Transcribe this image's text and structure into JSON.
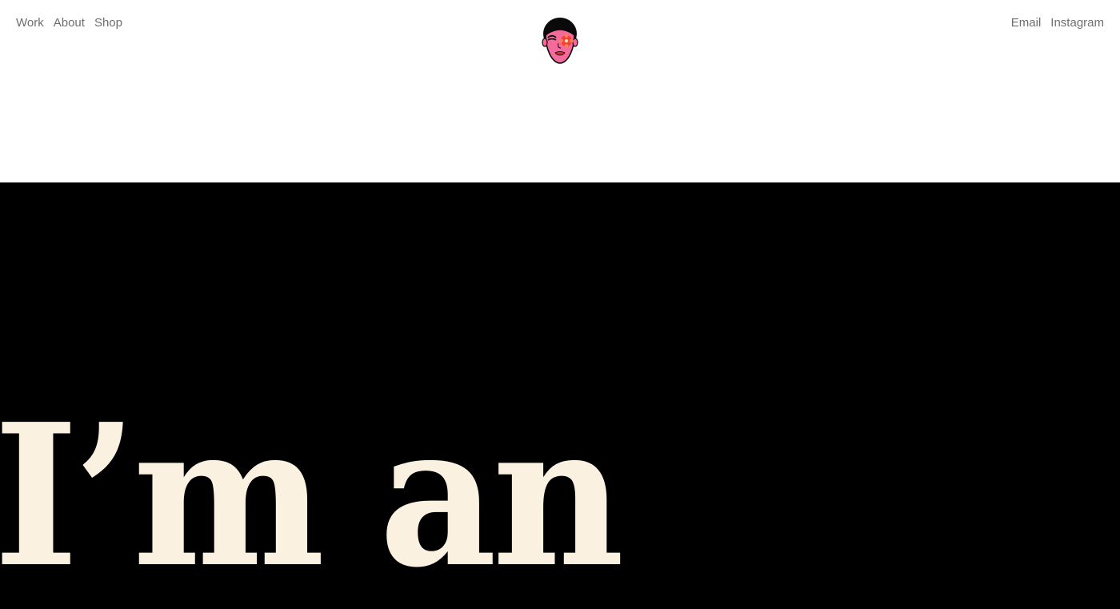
{
  "nav": {
    "left": [
      {
        "label": "Work"
      },
      {
        "label": "About"
      },
      {
        "label": "Shop"
      }
    ],
    "right": [
      {
        "label": "Email"
      },
      {
        "label": "Instagram"
      }
    ]
  },
  "logo": {
    "icon": "face-avatar-icon"
  },
  "hero": {
    "headline": "I’m an"
  },
  "colors": {
    "hero_background": "#000000",
    "hero_text": "#fbf1e1",
    "nav_text": "#6e6e6e",
    "logo_skin": "#f46a9b",
    "logo_flower": "#f0442c"
  }
}
